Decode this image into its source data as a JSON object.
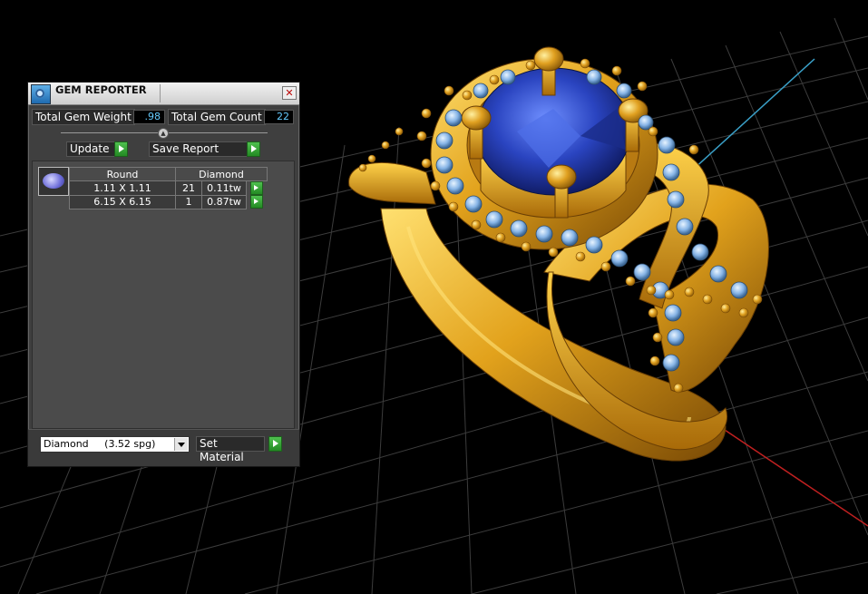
{
  "panel": {
    "title": "GEM REPORTER",
    "total_weight_label": "Total Gem Weight",
    "total_weight_value": ".98",
    "total_count_label": "Total Gem Count",
    "total_count_value": "22",
    "update_label": "Update",
    "save_report_label": "Save Report",
    "gem_group": {
      "shape": "Round",
      "material": "Diamond",
      "rows": [
        {
          "size": "1.11 X 1.11",
          "count": "21",
          "weight": "0.11tw"
        },
        {
          "size": "6.15 X 6.15",
          "count": "1",
          "weight": "0.87tw"
        }
      ]
    },
    "material_select_value": "Diamond     (3.52 spg)",
    "set_material_label": "Set Material"
  },
  "icons": {
    "app": "gem-reporter-icon",
    "close": "close-icon",
    "go": "green-arrow-icon",
    "dropdown": "chevron-down-icon",
    "slider": "collapse-knob-icon"
  },
  "colors": {
    "viewport_bg": "#000000",
    "grid": "#3a3a3a",
    "gold": "#e0a020",
    "sapphire": "#2244aa",
    "diamond": "#8ab8e8",
    "value_text": "#66ccff",
    "axis_x": "#c02020",
    "axis_y": "#3aa0c8"
  }
}
